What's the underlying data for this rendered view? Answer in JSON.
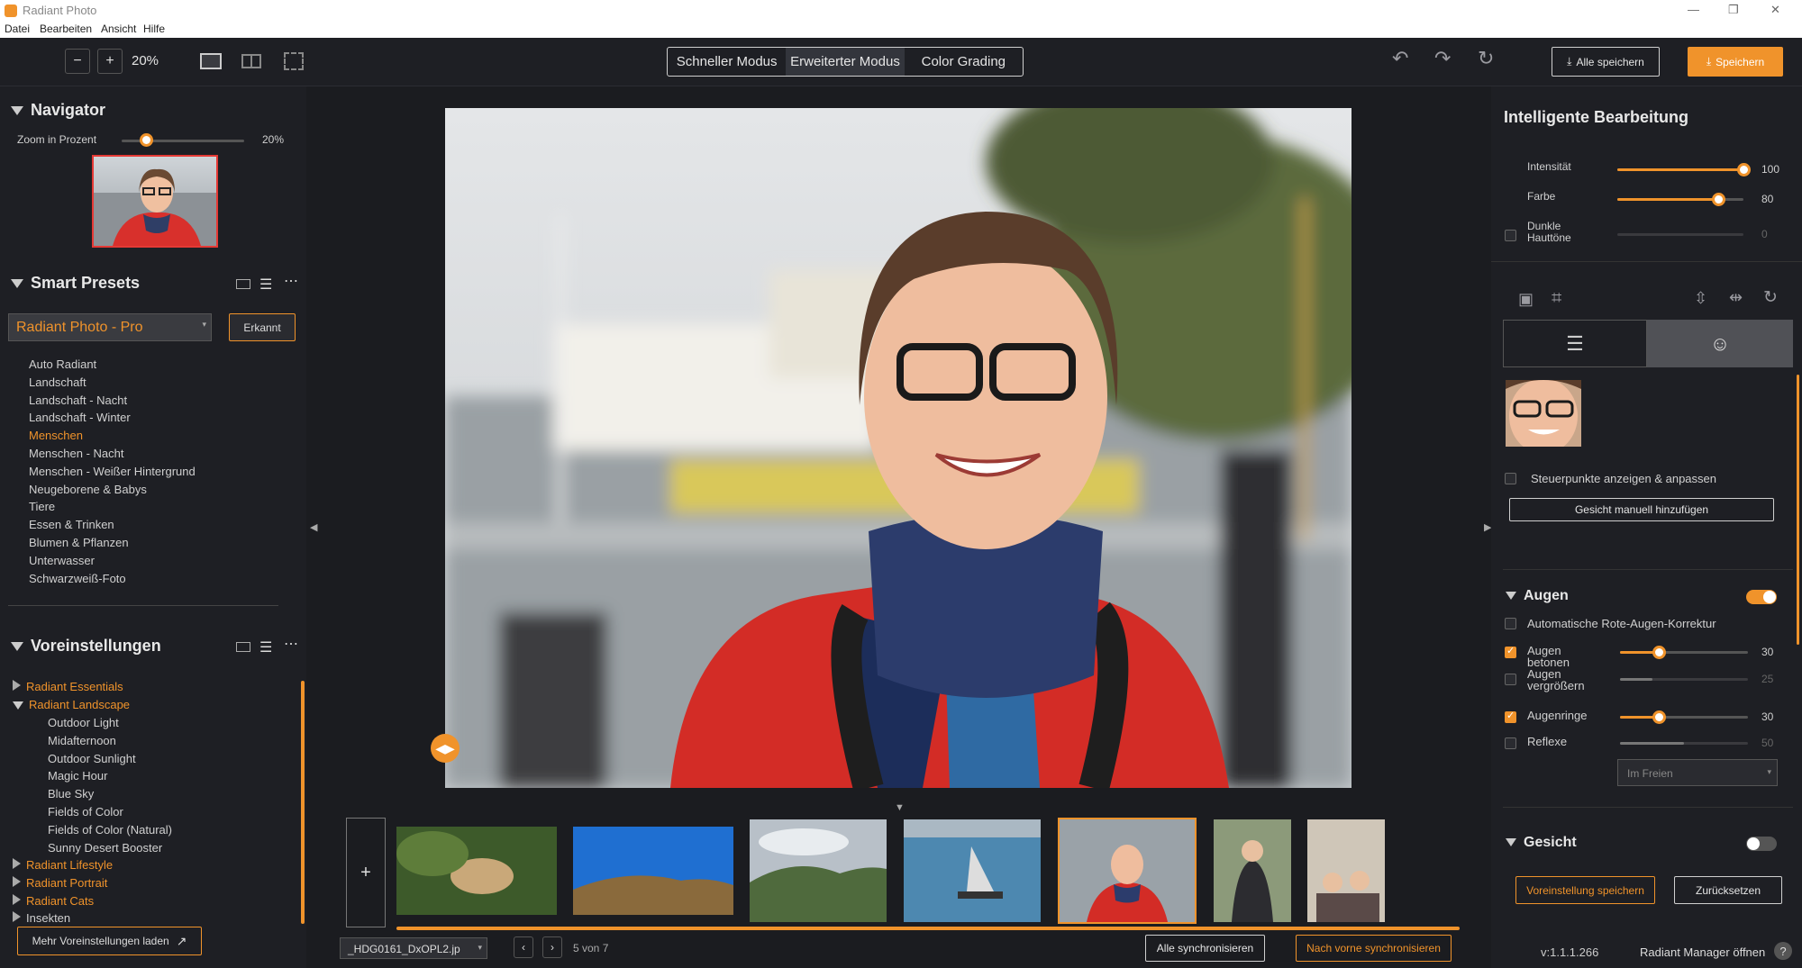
{
  "app": {
    "title": "Radiant Photo"
  },
  "menu": [
    "Datei",
    "Bearbeiten",
    "Ansicht",
    "Hilfe"
  ],
  "window": {
    "minimize": "—",
    "maximize": "❐",
    "close": "✕"
  },
  "toolbar": {
    "zoom_minus": "−",
    "zoom_plus": "+",
    "zoom_level": "20%",
    "modes": [
      "Schneller Modus",
      "Erweiterter Modus",
      "Color Grading"
    ],
    "save_all": "Alle speichern",
    "save": "Speichern"
  },
  "navigator": {
    "title": "Navigator",
    "zoom_label": "Zoom in Prozent",
    "zoom_value": "20%",
    "zoom_fraction": 0.2
  },
  "smart_presets": {
    "title": "Smart Presets",
    "selected": "Radiant Photo - Pro",
    "recognized": "Erkannt",
    "items": [
      "Auto Radiant",
      "Landschaft",
      "Landschaft - Nacht",
      "Landschaft - Winter",
      "Menschen",
      "Menschen - Nacht",
      "Menschen - Weißer Hintergrund",
      "Neugeborene & Babys",
      "Tiere",
      "Essen & Trinken",
      "Blumen & Pflanzen",
      "Unterwasser",
      "Schwarzweiß-Foto"
    ],
    "active_index": 4
  },
  "presets": {
    "title": "Voreinstellungen",
    "group1": "Radiant Essentials",
    "group2": "Radiant Landscape",
    "landscape_items": [
      "Outdoor Light",
      "Midafternoon",
      "Outdoor Sunlight",
      "Magic Hour",
      "Blue Sky",
      "Fields of Color",
      "Fields of Color (Natural)",
      "Sunny Desert Booster"
    ],
    "group3": "Radiant Lifestyle",
    "group4": "Radiant Portrait",
    "group5": "Radiant Cats",
    "group6": "Insekten",
    "load_more": "Mehr Voreinstellungen laden"
  },
  "filmstrip": {
    "add": "+",
    "filename": "_HDG0161_DxOPL2.jp",
    "counter": "5 von 7",
    "sync_all": "Alle synchronisieren",
    "sync_forward": "Nach vorne synchronisieren"
  },
  "smart_edit": {
    "title": "Intelligente Bearbeitung",
    "sliders": [
      {
        "label": "Intensität",
        "value": "100",
        "fraction": 1.0
      },
      {
        "label": "Farbe",
        "value": "80",
        "fraction": 0.8
      },
      {
        "label": "Dunkle Hauttöne",
        "value": "0",
        "fraction": 0.0
      }
    ]
  },
  "face": {
    "control_points": "Steuerpunkte anzeigen & anpassen",
    "add_face": "Gesicht manuell hinzufügen"
  },
  "eyes": {
    "title": "Augen",
    "enabled": true,
    "red_eye": "Automatische Rote-Augen-Korrektur",
    "sliders": [
      {
        "label": "Augen betonen",
        "value": "30",
        "fraction": 0.3,
        "checked": true
      },
      {
        "label": "Augen vergrößern",
        "value": "25",
        "fraction": 0.25,
        "checked": false
      },
      {
        "label": "Augenringe",
        "value": "30",
        "fraction": 0.3,
        "checked": true
      },
      {
        "label": "Reflexe",
        "value": "50",
        "fraction": 0.5,
        "checked": false
      }
    ],
    "environment": "Im Freien"
  },
  "face_section": {
    "title": "Gesicht",
    "enabled": false
  },
  "footer": {
    "save_preset": "Voreinstellung speichern",
    "reset": "Zurücksetzen",
    "version": "v:1.1.1.266",
    "manager": "Radiant Manager öffnen",
    "help": "?"
  },
  "colors": {
    "accent": "#f0932b",
    "bg": "#1e1f24"
  }
}
